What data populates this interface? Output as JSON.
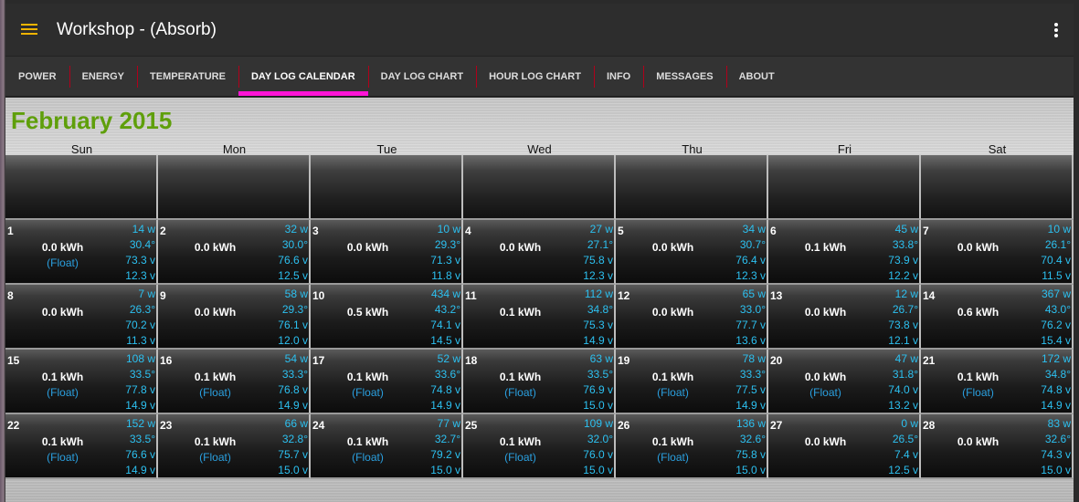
{
  "app_bar": {
    "title": "Workshop - (Absorb)"
  },
  "tabs": [
    {
      "label": "POWER"
    },
    {
      "label": "ENERGY"
    },
    {
      "label": "TEMPERATURE"
    },
    {
      "label": "DAY LOG CALENDAR"
    },
    {
      "label": "DAY LOG CHART"
    },
    {
      "label": "HOUR LOG CHART"
    },
    {
      "label": "INFO"
    },
    {
      "label": "MESSAGES"
    },
    {
      "label": "ABOUT"
    }
  ],
  "active_tab": "DAY LOG CALENDAR",
  "colors": {
    "accent_tab": "#ff14d6",
    "month_title": "#5f9f0b",
    "stat_text": "#2cc0f0",
    "menu_icon": "#f0b400"
  },
  "calendar": {
    "month_title": "February 2015",
    "weekdays": [
      "Sun",
      "Mon",
      "Tue",
      "Wed",
      "Thu",
      "Fri",
      "Sat"
    ],
    "weeks": [
      [
        {
          "empty": true
        },
        {
          "empty": true
        },
        {
          "empty": true
        },
        {
          "empty": true
        },
        {
          "empty": true
        },
        {
          "empty": true
        },
        {
          "empty": true
        }
      ],
      [
        {
          "day": "1",
          "kwh": "0.0 kWh",
          "mode": "(Float)",
          "watts": "14 w",
          "temp": "30.4°",
          "volts_a": "73.3 v",
          "volts_b": "12.3 v"
        },
        {
          "day": "2",
          "kwh": "0.0 kWh",
          "mode": "",
          "watts": "32 w",
          "temp": "30.0°",
          "volts_a": "76.6 v",
          "volts_b": "12.5 v"
        },
        {
          "day": "3",
          "kwh": "0.0 kWh",
          "mode": "",
          "watts": "10 w",
          "temp": "29.3°",
          "volts_a": "71.3 v",
          "volts_b": "11.8 v"
        },
        {
          "day": "4",
          "kwh": "0.0 kWh",
          "mode": "",
          "watts": "27 w",
          "temp": "27.1°",
          "volts_a": "75.8 v",
          "volts_b": "12.3 v"
        },
        {
          "day": "5",
          "kwh": "0.0 kWh",
          "mode": "",
          "watts": "34 w",
          "temp": "30.7°",
          "volts_a": "76.4 v",
          "volts_b": "12.3 v"
        },
        {
          "day": "6",
          "kwh": "0.1 kWh",
          "mode": "",
          "watts": "45 w",
          "temp": "33.8°",
          "volts_a": "73.9 v",
          "volts_b": "12.2 v"
        },
        {
          "day": "7",
          "kwh": "0.0 kWh",
          "mode": "",
          "watts": "10 w",
          "temp": "26.1°",
          "volts_a": "70.4 v",
          "volts_b": "11.5 v"
        }
      ],
      [
        {
          "day": "8",
          "kwh": "0.0 kWh",
          "mode": "",
          "watts": "7 w",
          "temp": "26.3°",
          "volts_a": "70.2 v",
          "volts_b": "11.3 v"
        },
        {
          "day": "9",
          "kwh": "0.0 kWh",
          "mode": "",
          "watts": "58 w",
          "temp": "29.3°",
          "volts_a": "76.1 v",
          "volts_b": "12.0 v"
        },
        {
          "day": "10",
          "kwh": "0.5 kWh",
          "mode": "",
          "watts": "434 w",
          "temp": "43.2°",
          "volts_a": "74.1 v",
          "volts_b": "14.5 v"
        },
        {
          "day": "11",
          "kwh": "0.1 kWh",
          "mode": "",
          "watts": "112 w",
          "temp": "34.8°",
          "volts_a": "75.3 v",
          "volts_b": "14.9 v"
        },
        {
          "day": "12",
          "kwh": "0.0 kWh",
          "mode": "",
          "watts": "65 w",
          "temp": "33.0°",
          "volts_a": "77.7 v",
          "volts_b": "13.6 v"
        },
        {
          "day": "13",
          "kwh": "0.0 kWh",
          "mode": "",
          "watts": "12 w",
          "temp": "26.7°",
          "volts_a": "73.8 v",
          "volts_b": "12.1 v"
        },
        {
          "day": "14",
          "kwh": "0.6 kWh",
          "mode": "",
          "watts": "367 w",
          "temp": "43.0°",
          "volts_a": "76.2 v",
          "volts_b": "15.4 v"
        }
      ],
      [
        {
          "day": "15",
          "kwh": "0.1 kWh",
          "mode": "(Float)",
          "watts": "108 w",
          "temp": "33.5°",
          "volts_a": "77.8 v",
          "volts_b": "14.9 v"
        },
        {
          "day": "16",
          "kwh": "0.1 kWh",
          "mode": "(Float)",
          "watts": "54 w",
          "temp": "33.3°",
          "volts_a": "76.8 v",
          "volts_b": "14.9 v"
        },
        {
          "day": "17",
          "kwh": "0.1 kWh",
          "mode": "(Float)",
          "watts": "52 w",
          "temp": "33.6°",
          "volts_a": "74.8 v",
          "volts_b": "14.9 v"
        },
        {
          "day": "18",
          "kwh": "0.1 kWh",
          "mode": "(Float)",
          "watts": "63 w",
          "temp": "33.5°",
          "volts_a": "76.9 v",
          "volts_b": "15.0 v"
        },
        {
          "day": "19",
          "kwh": "0.1 kWh",
          "mode": "(Float)",
          "watts": "78 w",
          "temp": "33.3°",
          "volts_a": "77.5 v",
          "volts_b": "14.9 v"
        },
        {
          "day": "20",
          "kwh": "0.0 kWh",
          "mode": "(Float)",
          "watts": "47 w",
          "temp": "31.8°",
          "volts_a": "74.0 v",
          "volts_b": "13.2 v"
        },
        {
          "day": "21",
          "kwh": "0.1 kWh",
          "mode": "(Float)",
          "watts": "172 w",
          "temp": "34.8°",
          "volts_a": "74.8 v",
          "volts_b": "14.9 v"
        }
      ],
      [
        {
          "day": "22",
          "kwh": "0.1 kWh",
          "mode": "(Float)",
          "watts": "152 w",
          "temp": "33.5°",
          "volts_a": "76.6 v",
          "volts_b": "14.9 v"
        },
        {
          "day": "23",
          "kwh": "0.1 kWh",
          "mode": "(Float)",
          "watts": "66 w",
          "temp": "32.8°",
          "volts_a": "75.7 v",
          "volts_b": "15.0 v"
        },
        {
          "day": "24",
          "kwh": "0.1 kWh",
          "mode": "(Float)",
          "watts": "77 w",
          "temp": "32.7°",
          "volts_a": "79.2 v",
          "volts_b": "15.0 v"
        },
        {
          "day": "25",
          "kwh": "0.1 kWh",
          "mode": "(Float)",
          "watts": "109 w",
          "temp": "32.0°",
          "volts_a": "76.0 v",
          "volts_b": "15.0 v"
        },
        {
          "day": "26",
          "kwh": "0.1 kWh",
          "mode": "(Float)",
          "watts": "136 w",
          "temp": "32.6°",
          "volts_a": "75.8 v",
          "volts_b": "15.0 v"
        },
        {
          "day": "27",
          "kwh": "0.0 kWh",
          "mode": "",
          "watts": "0 w",
          "temp": "26.5°",
          "volts_a": "7.4 v",
          "volts_b": "12.5 v"
        },
        {
          "day": "28",
          "kwh": "0.0 kWh",
          "mode": "",
          "watts": "83 w",
          "temp": "32.6°",
          "volts_a": "74.3 v",
          "volts_b": "15.0 v"
        }
      ]
    ]
  }
}
